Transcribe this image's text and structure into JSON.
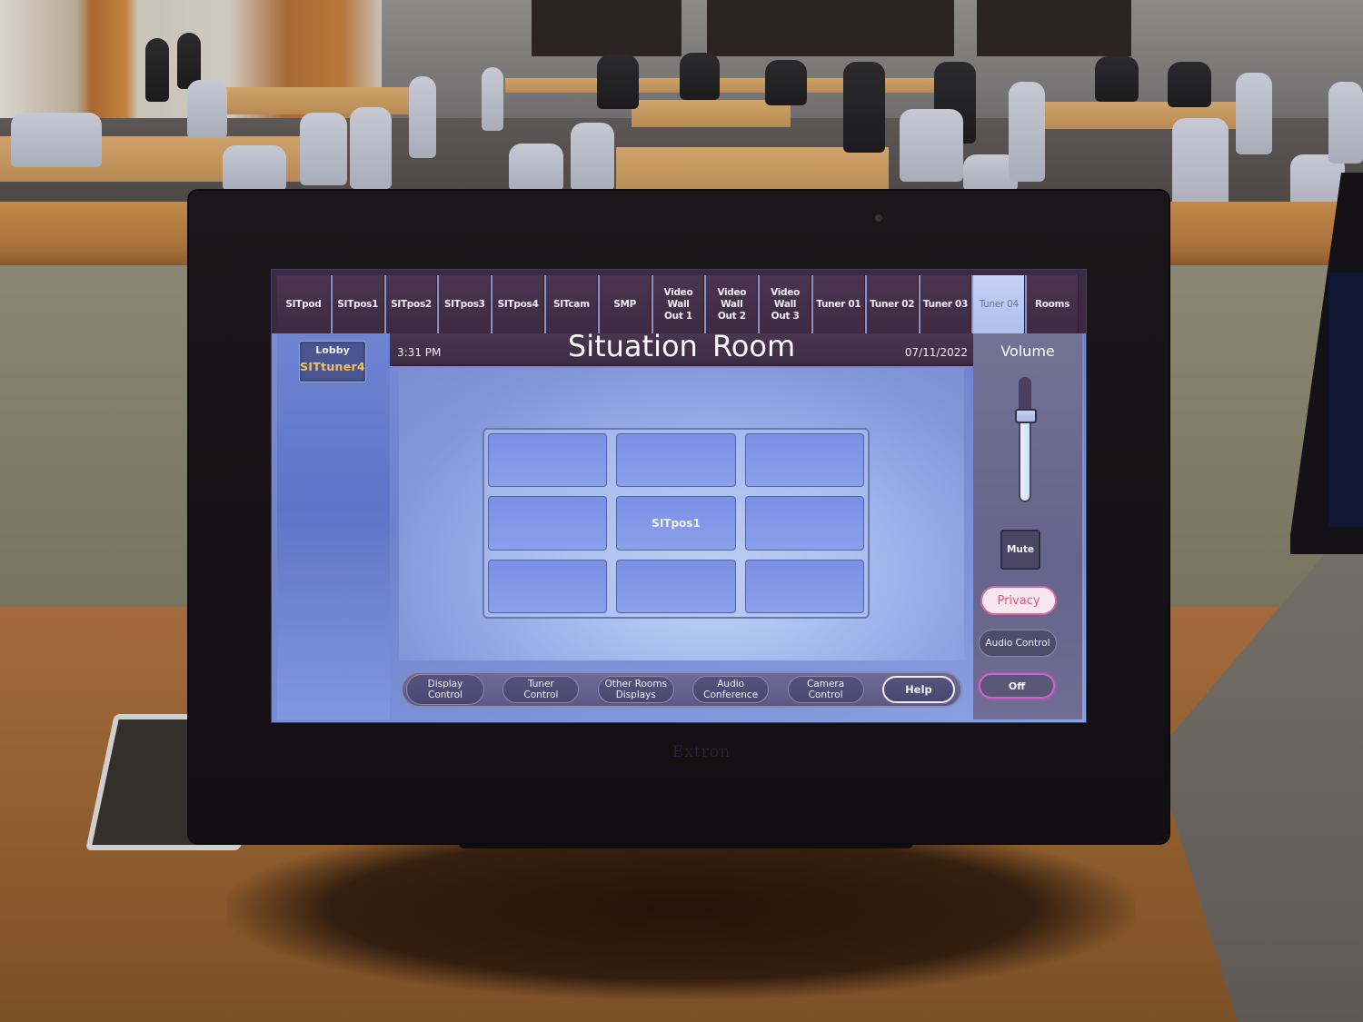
{
  "device": {
    "brand": "Extron"
  },
  "tabs": [
    {
      "label": "SITpod",
      "active": false
    },
    {
      "label": "SITpos1",
      "active": false
    },
    {
      "label": "SITpos2",
      "active": false
    },
    {
      "label": "SITpos3",
      "active": false
    },
    {
      "label": "SITpos4",
      "active": false
    },
    {
      "label": "SITcam",
      "active": false
    },
    {
      "label": "SMP",
      "active": false
    },
    {
      "label": "Video\nWall\nOut 1",
      "active": false
    },
    {
      "label": "Video\nWall\nOut 2",
      "active": false
    },
    {
      "label": "Video\nWall\nOut 3",
      "active": false
    },
    {
      "label": "Tuner 01",
      "active": false
    },
    {
      "label": "Tuner 02",
      "active": false
    },
    {
      "label": "Tuner 03",
      "active": false
    },
    {
      "label": "Tuner 04",
      "active": true
    },
    {
      "label": "Rooms",
      "active": false
    }
  ],
  "left_panel": {
    "lobby_title": "Lobby",
    "lobby_source": "SITtuner4",
    "lobby_source_color": "#f3c350"
  },
  "header": {
    "time": "3:31 PM",
    "title": "Situation Room",
    "date": "07/11/2022"
  },
  "video_wall": {
    "cells": [
      "",
      "",
      "",
      "",
      "SITpos1",
      "",
      "",
      "",
      ""
    ]
  },
  "bottom_nav": [
    {
      "label": "Display\nControl"
    },
    {
      "label": "Tuner\nControl"
    },
    {
      "label": "Other Rooms\nDisplays"
    },
    {
      "label": "Audio\nConference"
    },
    {
      "label": "Camera\nControl"
    },
    {
      "label": "Help"
    }
  ],
  "right_panel": {
    "volume_label": "Volume",
    "volume_level_percent": 71,
    "mute_label": "Mute",
    "privacy_label": "Privacy",
    "audio_control_label": "Audio Control",
    "off_label": "Off",
    "privacy_color": "#e0567f",
    "off_border_color": "#d65fd0"
  }
}
